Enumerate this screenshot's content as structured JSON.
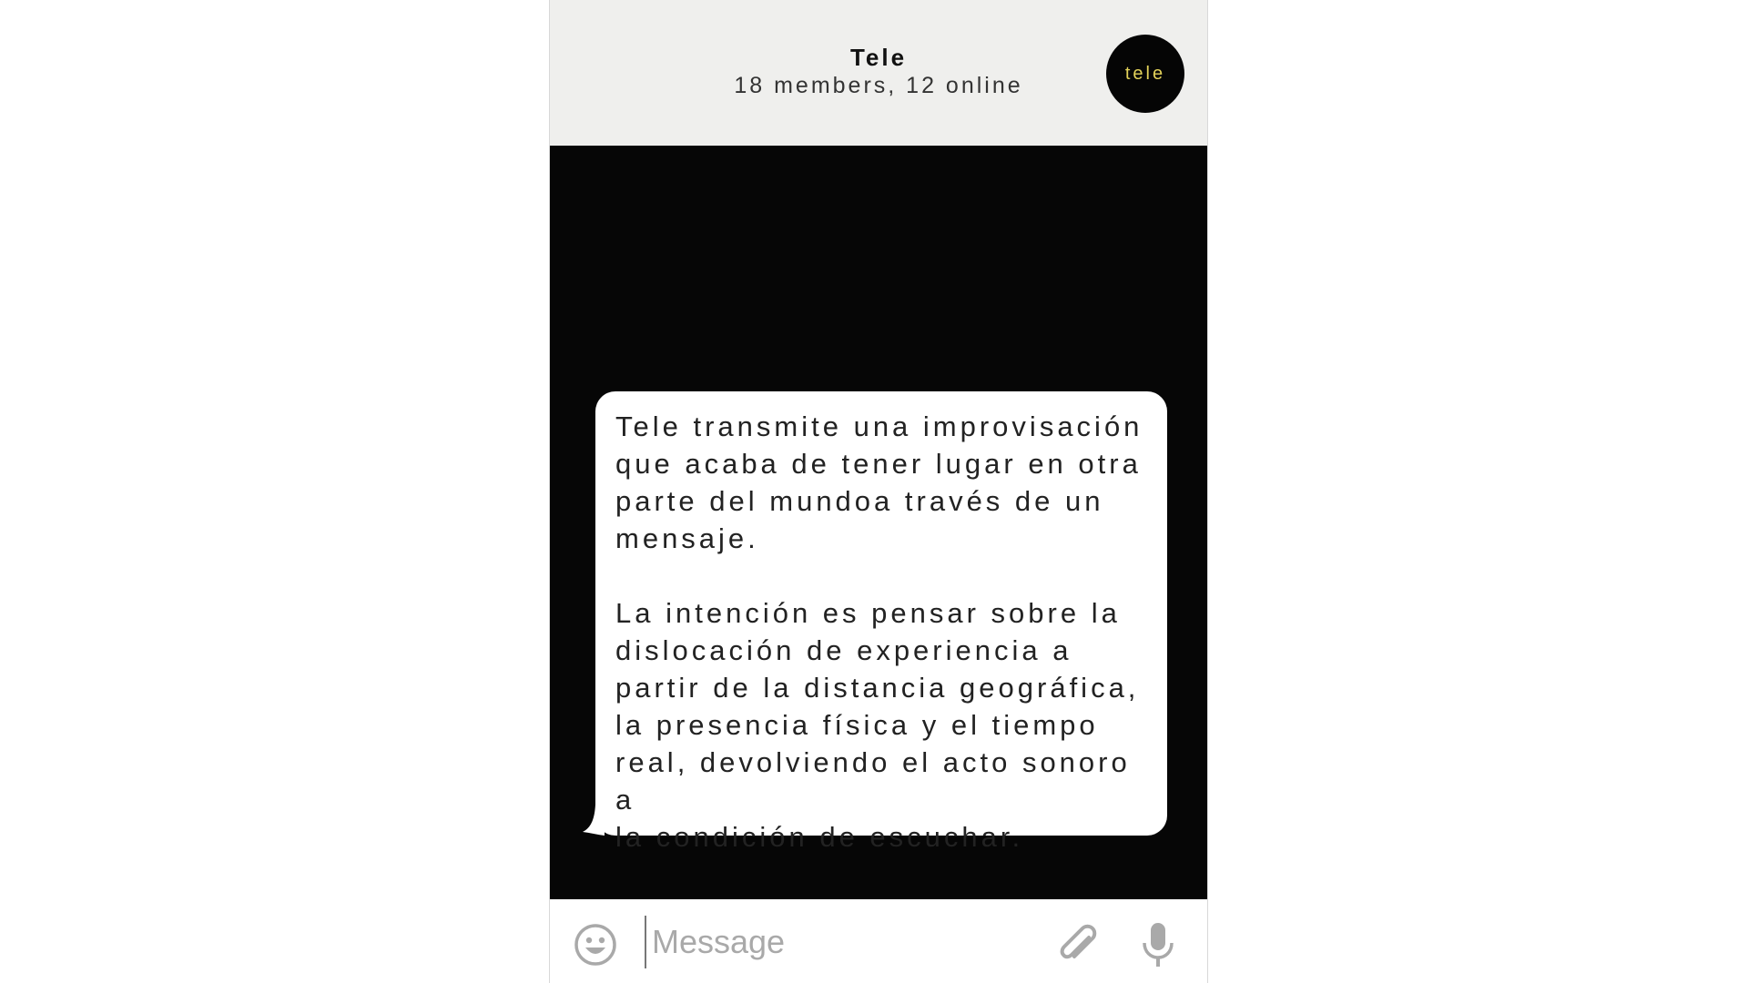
{
  "header": {
    "title": "Tele",
    "subtitle": "18 members, 12 online",
    "avatar_text": "tele"
  },
  "messages": [
    {
      "paragraph_1": "Tele transmite una improvisación\nque acaba de tener lugar en otra\nparte del mundoa través de un\nmensaje.",
      "paragraph_2": "La intención es pensar sobre la\ndislocación de experiencia a\npartir de la distancia geográfica,\nla presencia física y el tiempo\nreal, devolviendo el acto sonoro a\nla condición de escuchar."
    }
  ],
  "composer": {
    "placeholder": "Message",
    "value": "",
    "emoji_icon": "smiley-icon",
    "attach_icon": "paperclip-icon",
    "mic_icon": "microphone-icon"
  },
  "colors": {
    "header_bg": "#efefed",
    "chat_bg": "#060606",
    "bubble_bg": "#ffffff",
    "avatar_bg": "#050505",
    "avatar_text": "#e3d25a",
    "icon_gray": "#a9a9a9"
  }
}
